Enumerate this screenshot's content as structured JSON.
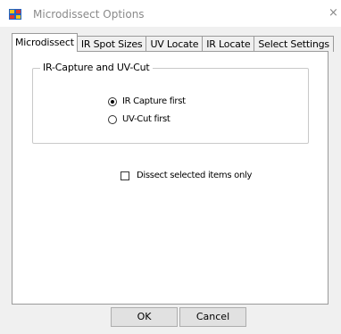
{
  "window": {
    "title": "Microdissect Options",
    "close_glyph": "×",
    "app_icon": "microdissect-app-icon"
  },
  "tabs": [
    {
      "label": "Microdissect",
      "active": true
    },
    {
      "label": "IR Spot Sizes",
      "active": false
    },
    {
      "label": "UV Locate",
      "active": false
    },
    {
      "label": "IR Locate",
      "active": false
    },
    {
      "label": "Select Settings",
      "active": false
    }
  ],
  "group": {
    "legend": "IR-Capture and UV-Cut",
    "options": [
      {
        "label": "IR Capture first",
        "selected": true
      },
      {
        "label": "UV-Cut first",
        "selected": false
      }
    ]
  },
  "checkbox": {
    "label": "Dissect selected items only",
    "checked": false
  },
  "buttons": {
    "ok": "OK",
    "cancel": "Cancel"
  }
}
